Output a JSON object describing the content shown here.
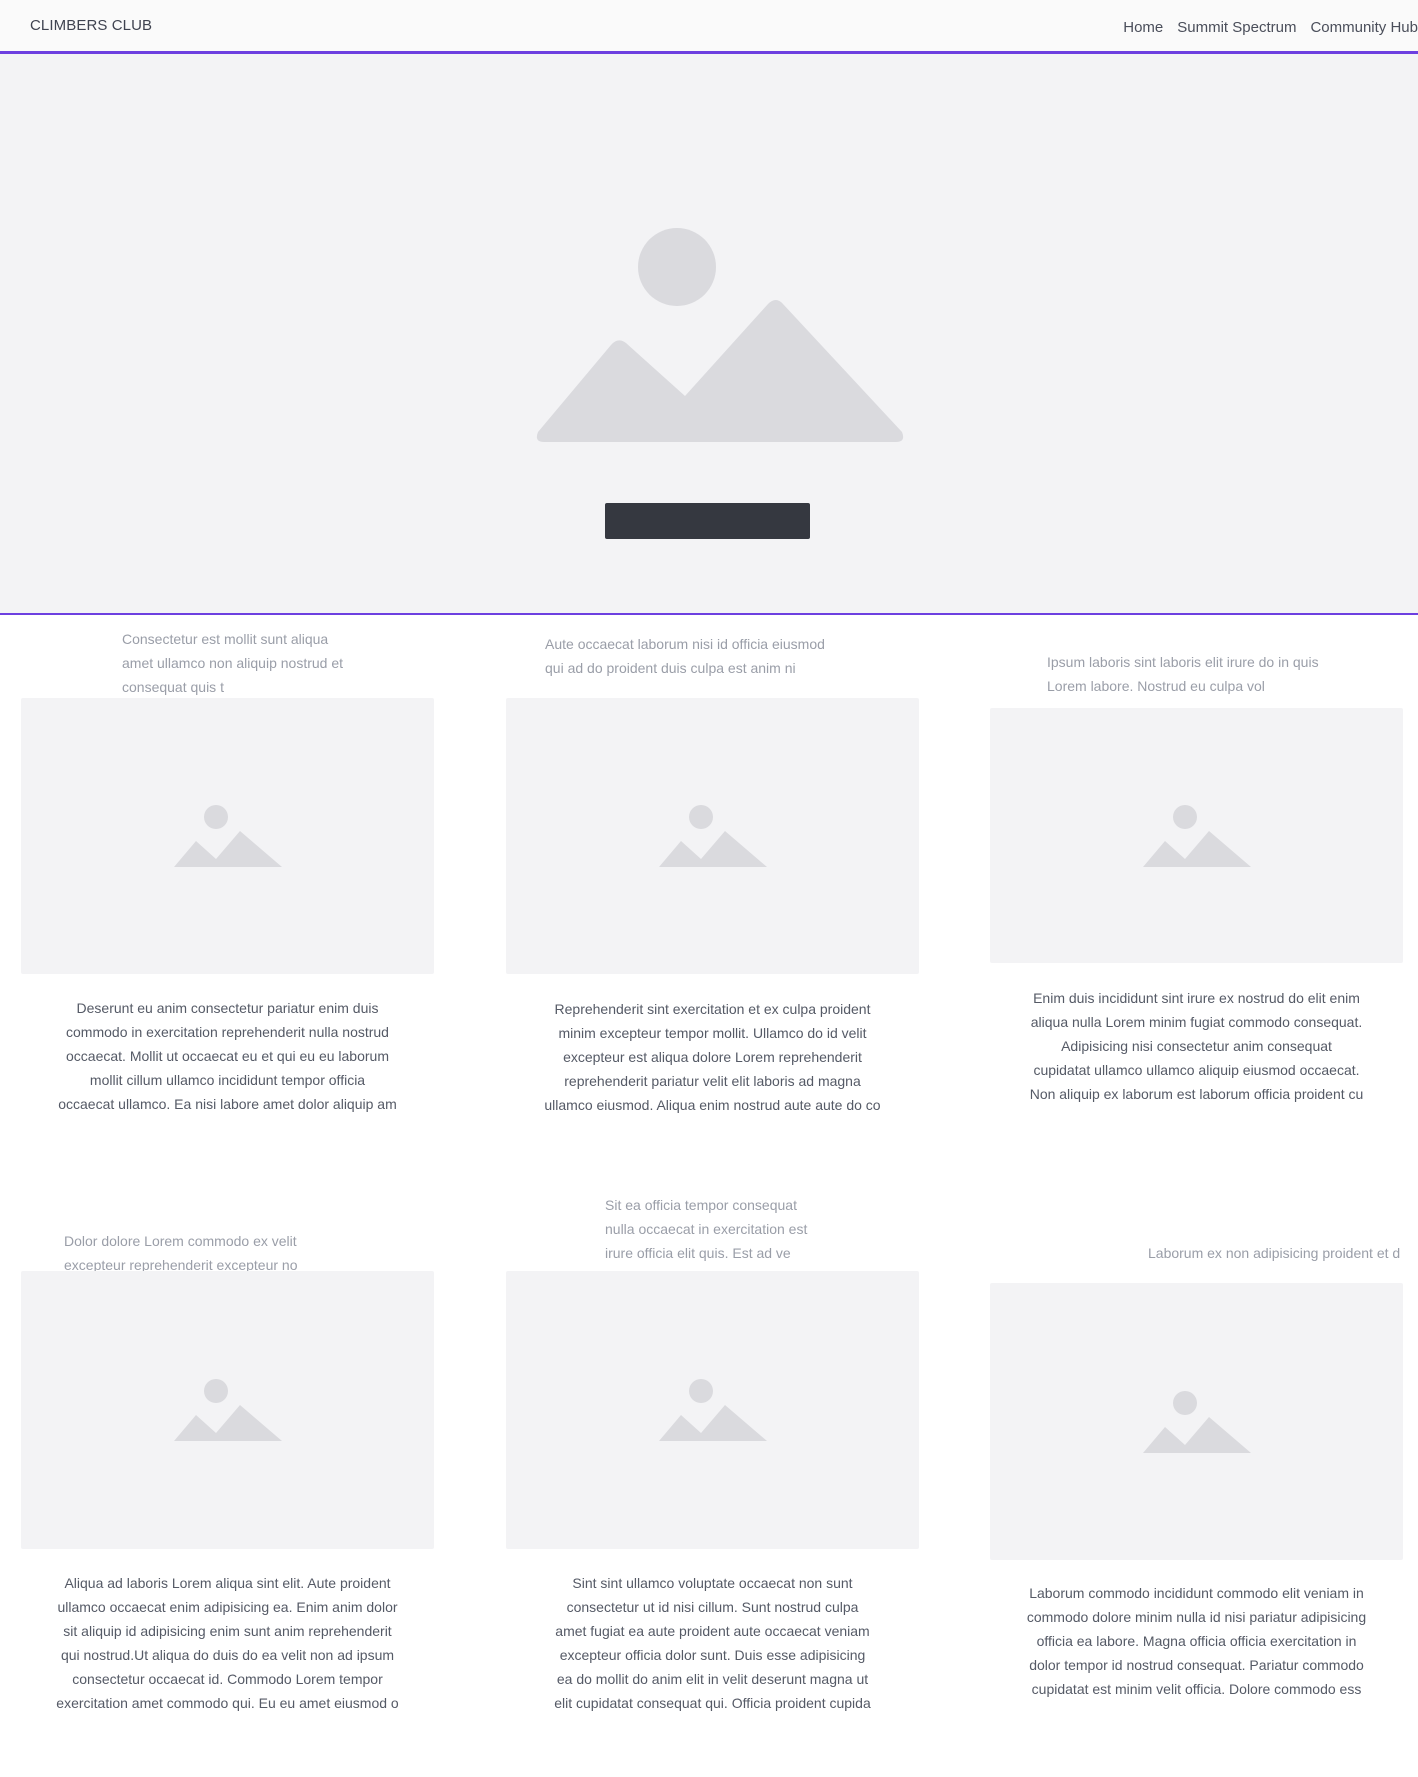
{
  "header": {
    "brand": "CLIMBERS CLUB",
    "nav": [
      "Home",
      "Summit Spectrum",
      "Community Hub"
    ]
  },
  "hero": {
    "image_icon": "image-placeholder-icon",
    "button_label": ""
  },
  "cards": [
    {
      "caption": [
        "Consectetur est mollit sunt aliqua",
        "amet ullamco non aliquip nostrud et",
        "consequat quis t"
      ],
      "description": [
        "Deserunt eu anim consectetur pariatur enim duis",
        "commodo in exercitation reprehenderit nulla nostrud",
        "occaecat. Mollit ut occaecat eu et qui eu eu laborum",
        "mollit cillum ullamco incididunt tempor officia",
        "occaecat ullamco. Ea nisi labore amet dolor aliquip am"
      ]
    },
    {
      "caption": [
        "Aute occaecat laborum nisi id officia eiusmod",
        "qui ad do proident duis culpa est anim ni"
      ],
      "description": [
        "Reprehenderit sint exercitation et ex culpa proident",
        "minim excepteur tempor mollit. Ullamco do id velit",
        "excepteur est aliqua dolore Lorem reprehenderit",
        "reprehenderit pariatur velit elit laboris ad magna",
        "ullamco eiusmod. Aliqua enim nostrud aute aute do co"
      ]
    },
    {
      "caption": [
        "Ipsum laboris sint laboris elit irure do in quis",
        "Lorem labore. Nostrud eu culpa vol"
      ],
      "description": [
        "Enim duis incididunt sint irure ex nostrud do elit enim",
        "aliqua nulla Lorem minim fugiat commodo consequat.",
        "Adipisicing nisi consectetur anim consequat",
        "cupidatat ullamco ullamco aliquip eiusmod occaecat.",
        "Non aliquip ex laborum est laborum officia proident cu"
      ]
    },
    {
      "caption": [
        "Dolor dolore Lorem commodo ex velit",
        "excepteur reprehenderit excepteur no"
      ],
      "description": [
        "Aliqua ad laboris Lorem aliqua sint elit. Aute proident",
        "ullamco occaecat enim adipisicing ea. Enim anim dolor",
        "sit aliquip id adipisicing enim sunt anim reprehenderit",
        "qui nostrud.Ut aliqua do duis do ea velit non ad ipsum",
        "consectetur occaecat id. Commodo Lorem tempor",
        "exercitation amet commodo qui. Eu eu amet eiusmod o"
      ]
    },
    {
      "caption": [
        "Sit ea officia tempor consequat",
        "nulla occaecat in exercitation est",
        "irure officia elit quis. Est ad ve"
      ],
      "description": [
        "Sint sint ullamco voluptate occaecat non sunt",
        "consectetur ut id nisi cillum. Sunt nostrud culpa",
        "amet fugiat ea aute proident aute occaecat veniam",
        "excepteur officia dolor sunt. Duis esse adipisicing",
        "ea do mollit do anim elit in velit deserunt magna ut",
        "elit cupidatat consequat qui. Officia proident cupida"
      ]
    },
    {
      "caption": [
        "Laborum ex non adipisicing proident et d"
      ],
      "description": [
        "Laborum commodo incididunt commodo elit veniam in",
        "commodo dolore minim nulla id nisi pariatur adipisicing",
        "officia ea labore. Magna officia officia exercitation in",
        "dolor tempor id nostrud consequat. Pariatur commodo",
        "cupidatat est minim velit officia. Dolore commodo ess"
      ]
    }
  ],
  "colors": {
    "accent": "#6d3fe0",
    "placeholder_bg": "#f3f3f5",
    "placeholder_icon": "#dadade",
    "hero_button": "#353840"
  }
}
